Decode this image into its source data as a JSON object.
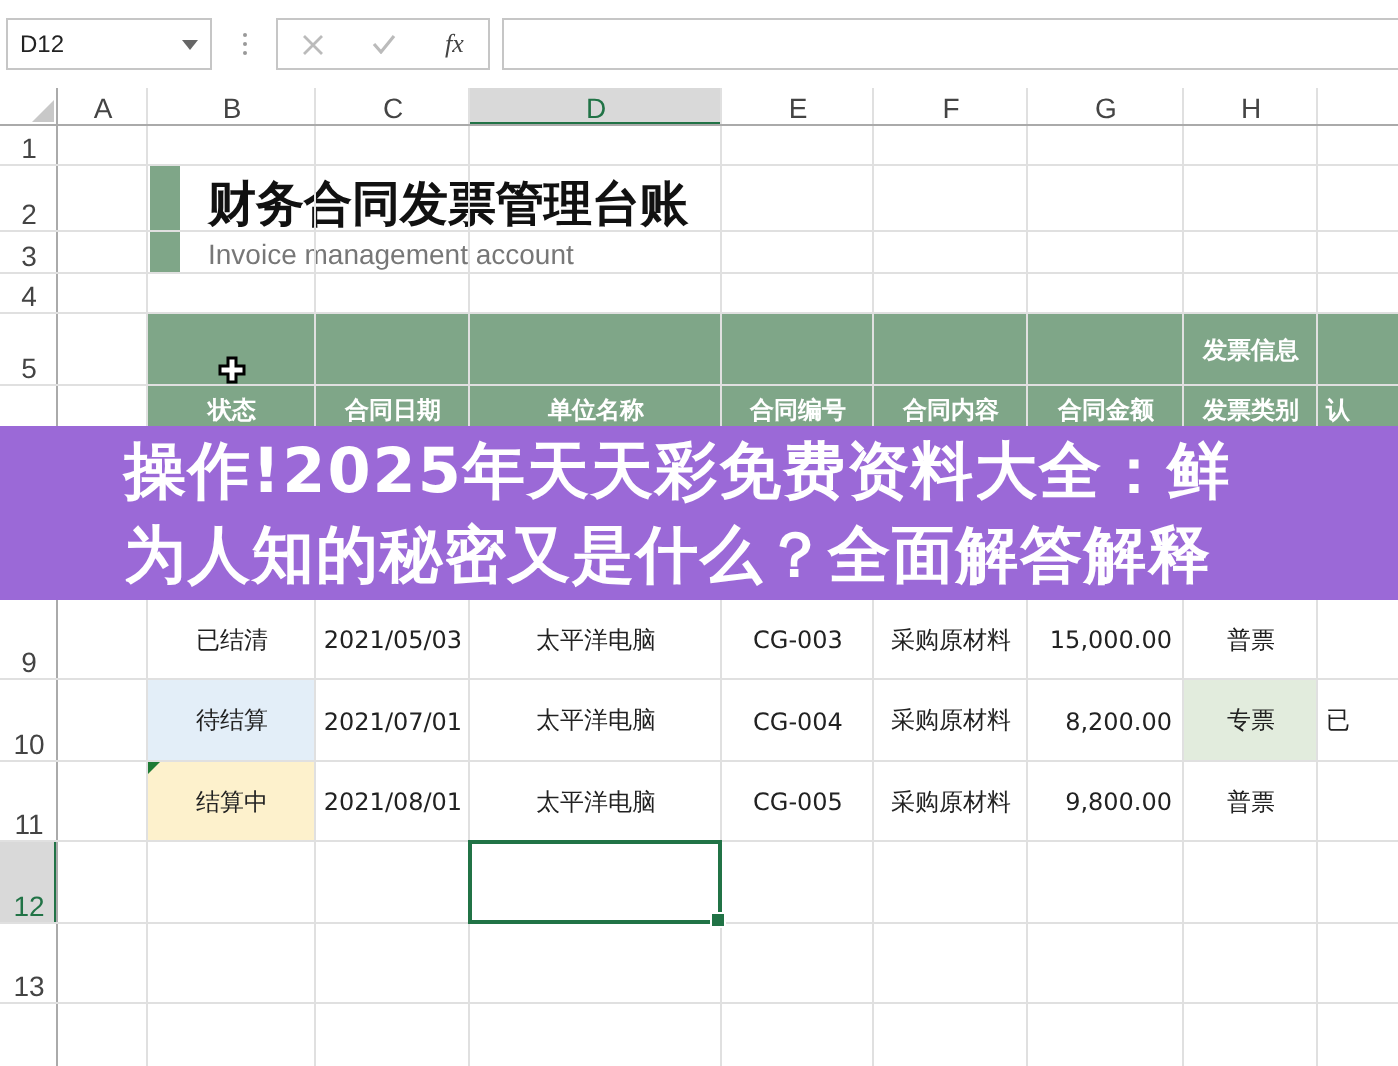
{
  "formula_bar": {
    "name_box": "D12",
    "fx": "fx"
  },
  "columns": [
    {
      "label": "A",
      "selected": false
    },
    {
      "label": "B",
      "selected": false
    },
    {
      "label": "C",
      "selected": false
    },
    {
      "label": "D",
      "selected": true
    },
    {
      "label": "E",
      "selected": false
    },
    {
      "label": "F",
      "selected": false
    },
    {
      "label": "G",
      "selected": false
    },
    {
      "label": "H",
      "selected": false
    }
  ],
  "rows": [
    {
      "label": "1",
      "selected": false
    },
    {
      "label": "2",
      "selected": false
    },
    {
      "label": "3",
      "selected": false
    },
    {
      "label": "4",
      "selected": false
    },
    {
      "label": "5",
      "selected": false
    },
    {
      "label": "9",
      "selected": false
    },
    {
      "label": "10",
      "selected": false
    },
    {
      "label": "11",
      "selected": false
    },
    {
      "label": "12",
      "selected": true
    },
    {
      "label": "13",
      "selected": false
    }
  ],
  "title": "财务合同发票管理台账",
  "subtitle": "Invoice management account",
  "table": {
    "group_header": "发票信息",
    "headers": [
      "状态",
      "合同日期",
      "单位名称",
      "合同编号",
      "合同内容",
      "合同金额",
      "发票类别",
      "认"
    ],
    "rows": [
      {
        "flagged": false,
        "status": {
          "text": "已结清"
        },
        "cells": [
          "2021/05/03",
          "太平洋电脑",
          "CG-003",
          "采购原材料",
          "15,000.00"
        ],
        "invoice_type": {
          "text": "普票"
        }
      },
      {
        "flagged": false,
        "status": {
          "text": "待结算",
          "color": "#e3eef8"
        },
        "cells": [
          "2021/07/01",
          "太平洋电脑",
          "CG-004",
          "采购原材料",
          "8,200.00"
        ],
        "invoice_type": {
          "text": "专票",
          "color": "#e2ecdd"
        },
        "column_8": "已"
      },
      {
        "flagged": true,
        "status": {
          "text": "结算中",
          "color": "#fdf1cc"
        },
        "cells": [
          "2021/08/01",
          "太平洋电脑",
          "CG-005",
          "采购原材料",
          "9,800.00"
        ],
        "invoice_type": {
          "text": "普票"
        }
      }
    ]
  },
  "banner": "操作!2025年天天彩免费资料大全：鲜为人知的秘密又是什么？全面解答解释"
}
